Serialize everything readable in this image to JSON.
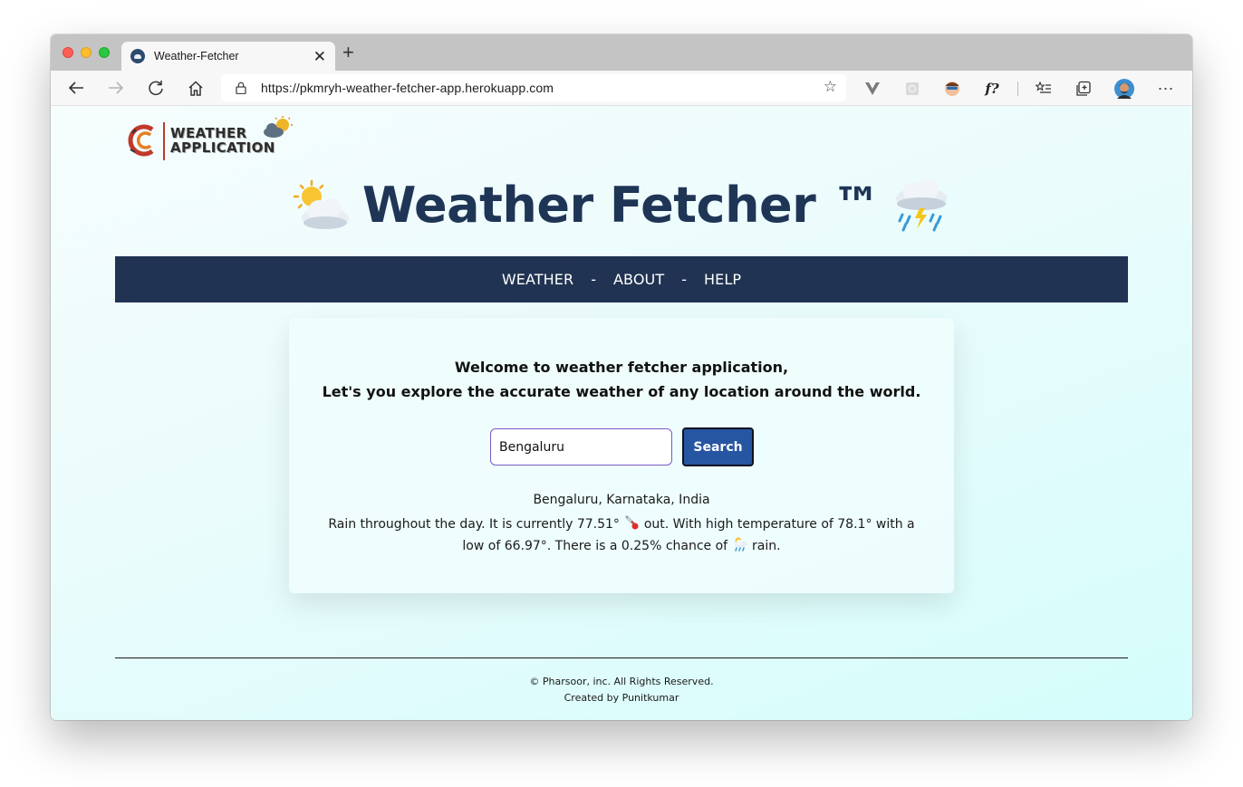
{
  "browser": {
    "tab_title": "Weather-Fetcher",
    "url": "https://pkmryh-weather-fetcher-app.herokuapp.com"
  },
  "logo": {
    "line1": "WEATHER",
    "line2": "APPLICATION"
  },
  "hero": {
    "title": "Weather Fetcher ™"
  },
  "nav": {
    "items": [
      "WEATHER",
      "ABOUT",
      "HELP"
    ],
    "separator": "-"
  },
  "card": {
    "welcome_line1": "Welcome to weather fetcher application,",
    "welcome_line2": "Let's you explore the accurate weather of any location around the world.",
    "search_value": "Bengaluru",
    "search_button": "Search",
    "location": "Bengaluru, Karnataka, India",
    "forecast_part1": "Rain throughout the day. It is currently 77.51°",
    "forecast_part2": "out. With high temperature of 78.1° with a low of 66.97°. There is a 0.25% chance of",
    "forecast_part3": "rain."
  },
  "footer": {
    "copyright": "© Pharsoor, inc. All Rights Reserved.",
    "credit": "Created by Punitkumar"
  },
  "colors": {
    "brand_navy": "#203352",
    "button_blue": "#2655a2",
    "input_border": "#7a5bc5"
  }
}
